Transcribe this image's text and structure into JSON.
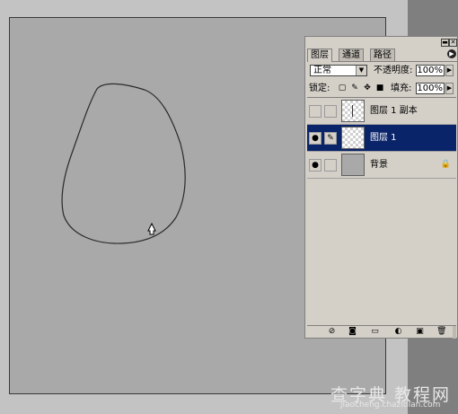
{
  "panel": {
    "tabs": [
      {
        "label": "图层",
        "active": true
      },
      {
        "label": "通道",
        "active": false
      },
      {
        "label": "路径",
        "active": false
      }
    ],
    "blend_mode": "正常",
    "opacity_label": "不透明度:",
    "opacity_value": "100%",
    "lock_label": "锁定:",
    "fill_label": "填充:",
    "fill_value": "100%",
    "layers": [
      {
        "name": "图层 1 副本",
        "visible": false,
        "selected": false
      },
      {
        "name": "图层 1",
        "visible": true,
        "selected": true
      },
      {
        "name": "背景",
        "visible": true,
        "selected": false,
        "locked": true
      }
    ]
  },
  "watermark": {
    "text": "查字典 教程网",
    "url": "jiaocheng.chazidian.com"
  },
  "colors": {
    "selected_layer": "#0a246a",
    "canvas": "#a9a9a9",
    "workspace": "#c3c3c3"
  }
}
